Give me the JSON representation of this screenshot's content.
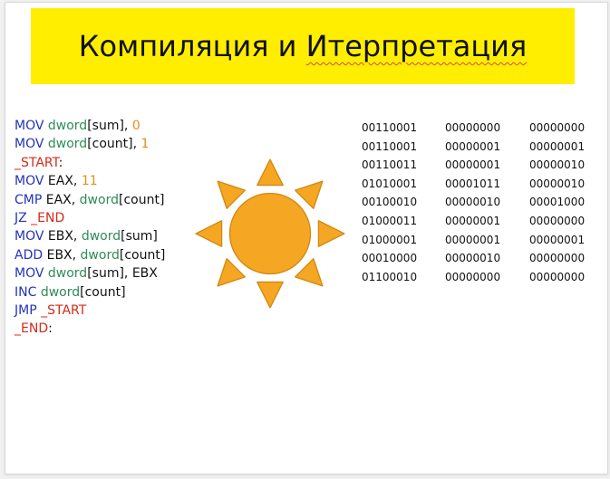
{
  "title": {
    "word1": "Компиляция и",
    "word2": "Итерпретация"
  },
  "colors": {
    "title_bg": "#ffee00",
    "keyword": "#2233bb",
    "type": "#2e8b57",
    "number": "#e0901a",
    "label": "#d42a1a",
    "sun_fill": "#f5a623",
    "sun_stroke": "#d08a12"
  },
  "sun_icon": "sun-icon",
  "code_lines": [
    [
      [
        "kw",
        "MOV "
      ],
      [
        "type",
        "dword"
      ],
      [
        "text",
        "[sum], "
      ],
      [
        "num",
        "0"
      ]
    ],
    [
      [
        "kw",
        "MOV "
      ],
      [
        "type",
        "dword"
      ],
      [
        "text",
        "[count], "
      ],
      [
        "num",
        "1"
      ]
    ],
    [
      [
        "label",
        "_START"
      ],
      [
        "text",
        ":"
      ]
    ],
    [
      [
        "kw",
        "MOV "
      ],
      [
        "text",
        "EAX, "
      ],
      [
        "num",
        "11"
      ]
    ],
    [
      [
        "kw",
        "CMP "
      ],
      [
        "text",
        "EAX, "
      ],
      [
        "type",
        "dword"
      ],
      [
        "text",
        "[count]"
      ]
    ],
    [
      [
        "kw",
        "JZ "
      ],
      [
        "label",
        "_END"
      ]
    ],
    [
      [
        "kw",
        "MOV "
      ],
      [
        "text",
        "EBX, "
      ],
      [
        "type",
        "dword"
      ],
      [
        "text",
        "[sum]"
      ]
    ],
    [
      [
        "kw",
        "ADD "
      ],
      [
        "text",
        "EBX, "
      ],
      [
        "type",
        "dword"
      ],
      [
        "text",
        "[count]"
      ]
    ],
    [
      [
        "kw",
        "MOV "
      ],
      [
        "type",
        "dword"
      ],
      [
        "text",
        "[sum], EBX"
      ]
    ],
    [
      [
        "kw",
        "INC "
      ],
      [
        "type",
        "dword"
      ],
      [
        "text",
        "[count]"
      ]
    ],
    [
      [
        "kw",
        "JMP "
      ],
      [
        "label",
        "_START"
      ]
    ],
    [
      [
        "label",
        "_END"
      ],
      [
        "text",
        ":"
      ]
    ]
  ],
  "binary_rows": [
    [
      "00110001",
      "00000000",
      "00000000"
    ],
    [
      "00110001",
      "00000001",
      "00000001"
    ],
    [
      "00110011",
      "00000001",
      "00000010"
    ],
    [
      "01010001",
      "00001011",
      "00000010"
    ],
    [
      "00100010",
      "00000010",
      "00001000"
    ],
    [
      "01000011",
      "00000001",
      "00000000"
    ],
    [
      "01000001",
      "00000001",
      "00000001"
    ],
    [
      "00010000",
      "00000010",
      "00000000"
    ],
    [
      "01100010",
      "00000000",
      "00000000"
    ]
  ]
}
